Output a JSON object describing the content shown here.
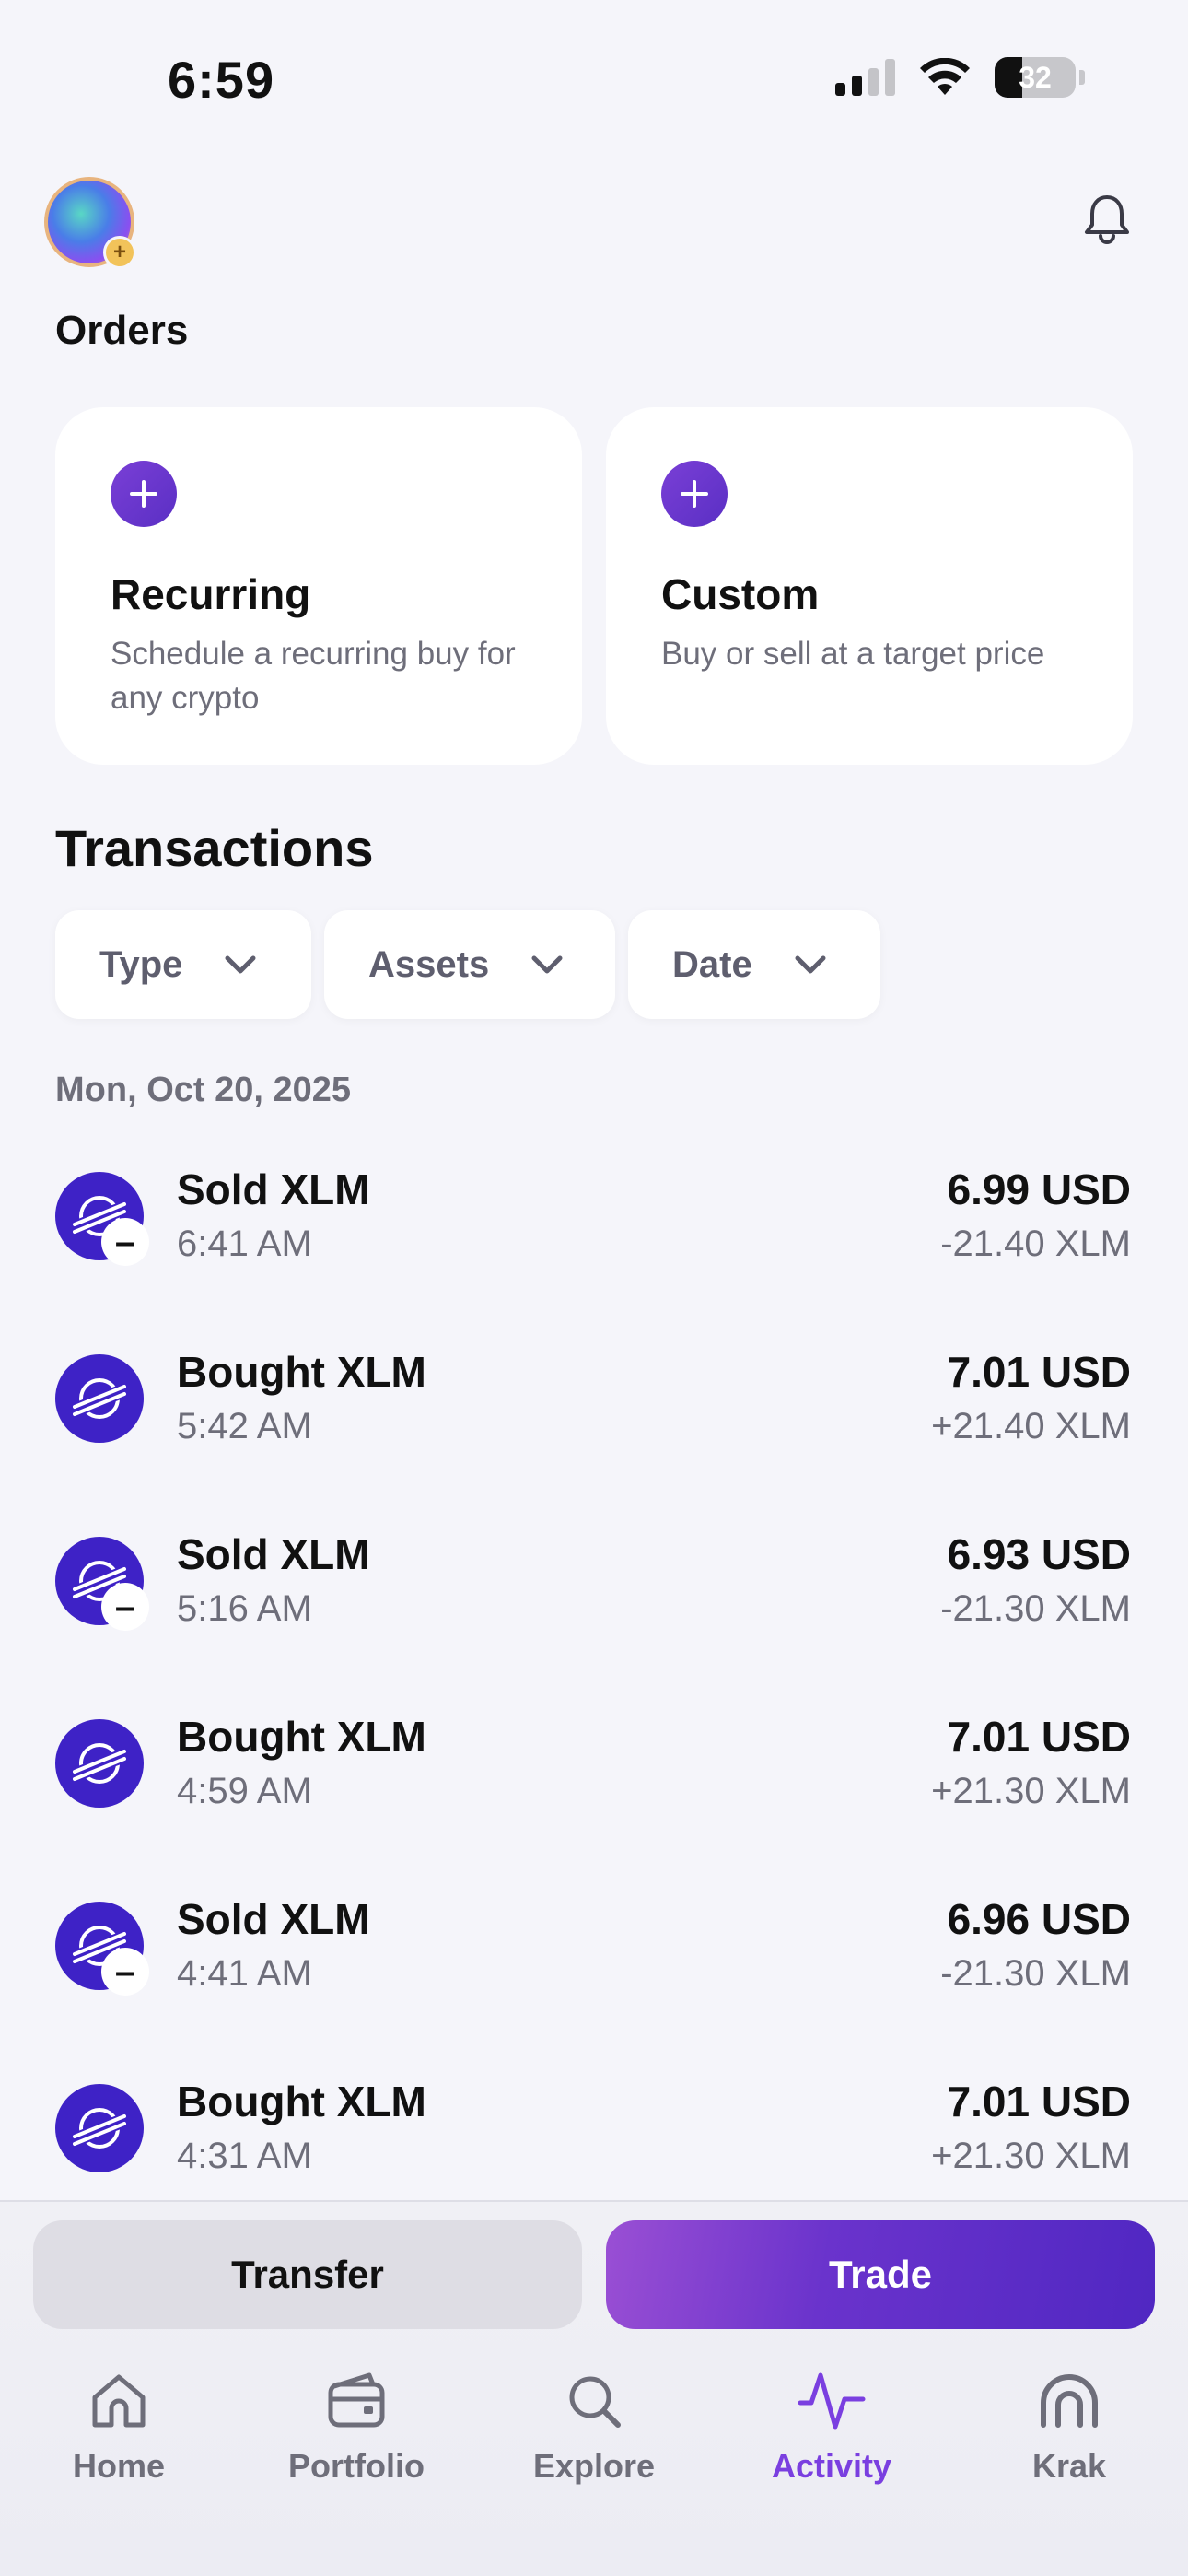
{
  "status": {
    "time": "6:59",
    "battery": "32"
  },
  "orders": {
    "title": "Orders",
    "cards": [
      {
        "title": "Recurring",
        "description": "Schedule a recurring buy for any crypto"
      },
      {
        "title": "Custom",
        "description": "Buy or sell at a target price"
      }
    ]
  },
  "transactions": {
    "title": "Transactions",
    "filters": [
      "Type",
      "Assets",
      "Date"
    ],
    "date_header": "Mon, Oct 20, 2025",
    "items": [
      {
        "title": "Sold XLM",
        "time": "6:41 AM",
        "amount": "6.99 USD",
        "qty": "-21.40 XLM",
        "kind": "sell"
      },
      {
        "title": "Bought XLM",
        "time": "5:42 AM",
        "amount": "7.01 USD",
        "qty": "+21.40 XLM",
        "kind": "buy"
      },
      {
        "title": "Sold XLM",
        "time": "5:16 AM",
        "amount": "6.93 USD",
        "qty": "-21.30 XLM",
        "kind": "sell"
      },
      {
        "title": "Bought XLM",
        "time": "4:59 AM",
        "amount": "7.01 USD",
        "qty": "+21.30 XLM",
        "kind": "buy"
      },
      {
        "title": "Sold XLM",
        "time": "4:41 AM",
        "amount": "6.96 USD",
        "qty": "-21.30 XLM",
        "kind": "sell"
      },
      {
        "title": "Bought XLM",
        "time": "4:31 AM",
        "amount": "7.01 USD",
        "qty": "+21.30 XLM",
        "kind": "buy"
      }
    ]
  },
  "actions": {
    "transfer": "Transfer",
    "trade": "Trade"
  },
  "tabs": [
    {
      "label": "Home",
      "icon": "home-icon"
    },
    {
      "label": "Portfolio",
      "icon": "wallet-icon"
    },
    {
      "label": "Explore",
      "icon": "search-icon"
    },
    {
      "label": "Activity",
      "icon": "activity-icon",
      "active": true
    },
    {
      "label": "Krak",
      "icon": "krak-icon"
    }
  ],
  "colors": {
    "accent": "#7a3fe0",
    "coin": "#3e22c6",
    "background": "#f5f5fa"
  }
}
